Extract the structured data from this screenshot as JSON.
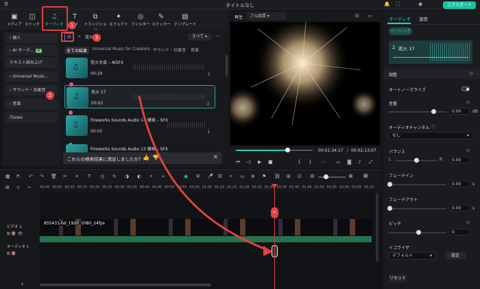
{
  "titlebar": {
    "title": "タイトルなし",
    "export": "エクスポート"
  },
  "toolbar": [
    {
      "label": "メディア",
      "icon": "media-icon"
    },
    {
      "label": "ストック",
      "icon": "stock-icon"
    },
    {
      "label": "オーディオ",
      "icon": "audio-icon"
    },
    {
      "label": "タイ",
      "icon": "title-icon"
    },
    {
      "label": "トランジション",
      "icon": "transition-icon"
    },
    {
      "label": "エフェクト",
      "icon": "effect-icon"
    },
    {
      "label": "フィルター",
      "icon": "filter-icon"
    },
    {
      "label": "ステッカー",
      "icon": "sticker-icon"
    },
    {
      "label": "テンプレート",
      "icon": "template-icon"
    }
  ],
  "sidebar": [
    "個人",
    "AI オーデ...",
    "テキスト読み上げ",
    "Universal Music...",
    "サウンド・効果音",
    "音楽",
    "iTunes"
  ],
  "sidebar_ai_badge": "AI",
  "search": {
    "value": "花火",
    "filter": "すべて"
  },
  "media_tabs": [
    "全ての結果",
    "Universal Music for Creators",
    "サウンド・効果音",
    "音楽"
  ],
  "media_items": [
    {
      "name": "花火大会 – AISFX",
      "duration": "00:29"
    },
    {
      "name": "花火 17",
      "duration": "00:02"
    },
    {
      "name": "Fireworks Sounds Audio 14 爆発 – SFX",
      "duration": "00:05"
    },
    {
      "name": "Fireworks Sounds Audio 13 爆発 – SFX",
      "duration": ""
    }
  ],
  "survey": "これらの検索結果に満足しましたか？",
  "preview": {
    "label": "再生",
    "quality": "フル品質",
    "time_current": "00:01:34:17",
    "time_total": "00:02:13:07"
  },
  "rpanel": {
    "tabs": [
      "オーディオ",
      "速度"
    ],
    "subtab": "ベーシック",
    "clip_name": "花火 17",
    "section": "調整",
    "autonorm": "オートノーマライズ",
    "volume": "音量",
    "volume_val": "0.00",
    "volume_unit": "dB",
    "channel": "オーディオチャンネル",
    "channel_val": "なし",
    "balance": "バランス",
    "balance_l": "L",
    "balance_r": "R",
    "balance_val": "0.00",
    "fadein": "フェードイン",
    "fadein_val": "0.00",
    "fadein_unit": "s",
    "fadeout": "フェードアウト",
    "fadeout_val": "0.00",
    "fadeout_unit": "s",
    "pitch": "ピッチ",
    "pitch_val": "0",
    "eq": "イコライザ",
    "eq_val": "デフォルト",
    "eq_btn": "設定",
    "reset": "リセット"
  },
  "timeline": {
    "ticks": [
      "00:00",
      "00:05",
      "00:10",
      "00:15",
      "00:20",
      "00:25",
      "00:30",
      "00:35",
      "00:40",
      "00:45",
      "00:50",
      "00:55",
      "01:00",
      "01:05",
      "01:10",
      "01:15",
      "01:20",
      "01:25",
      "01:30",
      "01:35",
      "01:40",
      "01:45",
      "01:50",
      "01:55",
      "02:00",
      "02:05",
      "02:10"
    ],
    "video_track": "ビデオ 1",
    "audio_track": "オーディオ 1",
    "clip": "855431-hd_1920_1080_24fps"
  },
  "badges": [
    "1",
    "2",
    "3"
  ]
}
